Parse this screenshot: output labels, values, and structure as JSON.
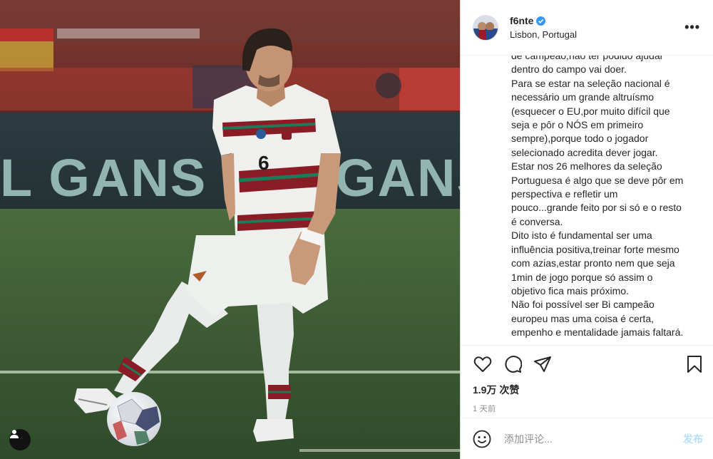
{
  "post": {
    "username": "f6nte",
    "location": "Lisbon, Portugal",
    "verified": true,
    "more_icon_text": "•••",
    "caption_lines": [
      "de campeão,não ter podido ajudar",
      "dentro do campo vai doer.",
      "Para se estar na seleção nacional é",
      "necessário um grande altruísmo",
      "(esquecer o EU,por muito difícil que",
      "seja e pôr o NÓS em primeiro",
      "sempre),porque todo o jogador",
      "selecionado acredita dever jogar.",
      "Estar nos 26 melhores da seleção",
      "Portuguesa é algo que se deve pôr em",
      "perspectiva e refletir um",
      "pouco...grande feito por si só e o resto",
      "é conversa.",
      "Dito isto é fundamental ser uma",
      "influência positiva,treinar forte mesmo",
      "com azias,estar pronto nem que seja",
      "1min de jogo porque só assim o",
      "objetivo fica mais próximo.",
      "Não foi possível ser Bi campeão",
      "europeu mas uma coisa é certa,",
      "empenho e mentalidade jamais faltará."
    ],
    "likes": "1.9万 次赞",
    "time": "1 天前",
    "comment_placeholder": "添加评论...",
    "publish_label": "发布",
    "photo": {
      "banner_text": "L GANS",
      "banner_text_right": "GANS",
      "jersey_number": "6"
    }
  },
  "icons": {
    "like": "heart-icon",
    "comment": "comment-icon",
    "share": "share-icon",
    "save": "bookmark-icon",
    "emoji": "emoji-icon",
    "user_tag": "person-icon",
    "verified": "verified-badge-icon",
    "more": "more-options-icon"
  },
  "colors": {
    "verified_blue": "#3897f0",
    "publish_disabled": "#b2dffc",
    "secondary_text": "#8e8e8e",
    "jersey_red": "#9a1b27",
    "jersey_green": "#1f7a5a",
    "pitch_green": "#3f5e35"
  }
}
